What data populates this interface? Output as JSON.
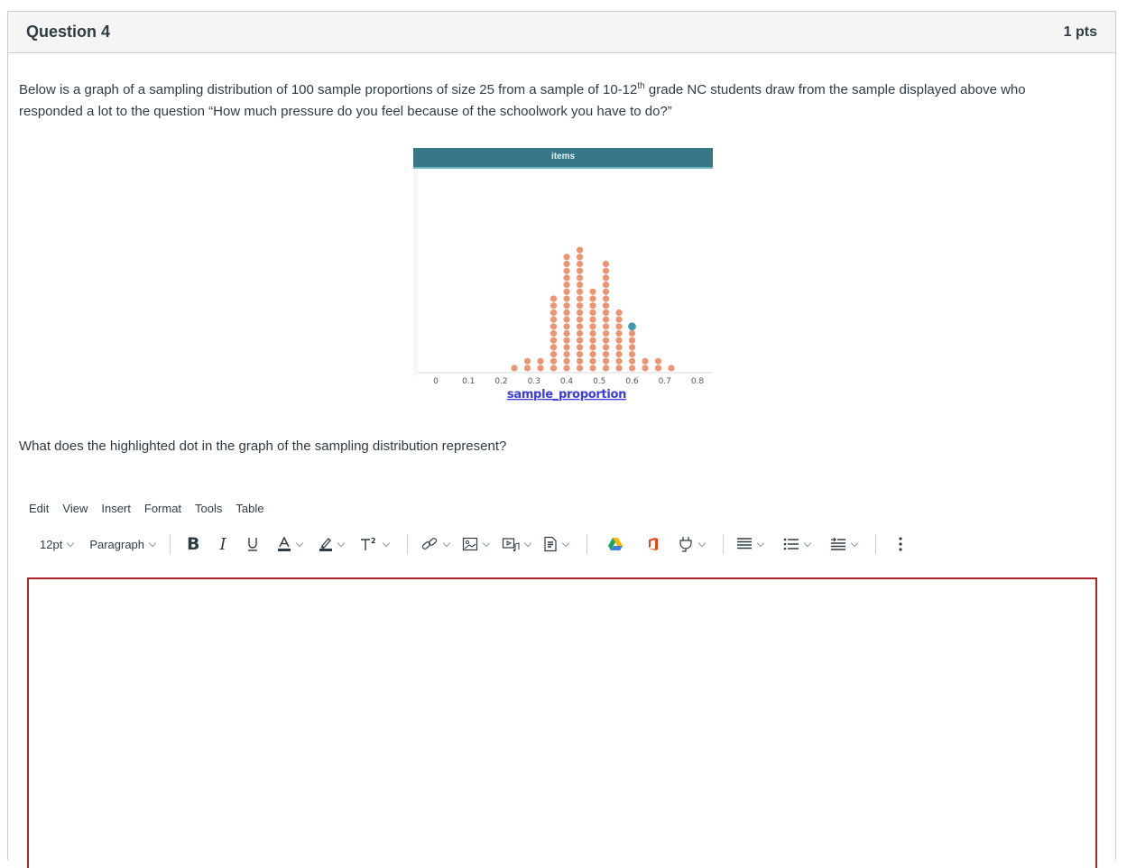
{
  "question": {
    "title": "Question 4",
    "points": "1 pts",
    "text_before_sup": "Below is a graph of a sampling distribution of 100 sample proportions of size 25 from a sample of 10-12",
    "text_sup": "th",
    "text_after_sup": " grade NC students draw from the sample displayed above who responded a lot to the question “How much pressure do you feel because of the schoolwork you have to do?”",
    "prompt": "What does the highlighted dot in the graph of the sampling distribution represent?"
  },
  "chart_data": {
    "type": "scatter",
    "subtype": "dot plot",
    "title": "items",
    "xlabel": "sample_proportion",
    "ylabel": "",
    "xlim": [
      0,
      0.8
    ],
    "x_ticks": [
      "0",
      "0.1",
      "0.2",
      "0.3",
      "0.4",
      "0.5",
      "0.6",
      "0.7",
      "0.8"
    ],
    "x_tick_values": [
      0,
      0.1,
      0.2,
      0.3,
      0.4,
      0.5,
      0.6,
      0.7,
      0.8
    ],
    "bins": [
      0.24,
      0.28,
      0.32,
      0.36,
      0.4,
      0.44,
      0.48,
      0.52,
      0.56,
      0.6,
      0.64,
      0.68,
      0.72
    ],
    "counts": [
      1,
      2,
      2,
      11,
      17,
      18,
      12,
      16,
      9,
      7,
      2,
      2,
      1
    ],
    "total": 100,
    "highlighted": {
      "x": 0.6,
      "stack_index": 7
    },
    "colors": {
      "dot": "#ec9572",
      "highlight": "#3f98ac",
      "header": "#367888"
    },
    "grid": false
  },
  "editor": {
    "menu": [
      "Edit",
      "View",
      "Insert",
      "Format",
      "Tools",
      "Table"
    ],
    "font_size": "12pt",
    "block_format": "Paragraph",
    "content": ""
  }
}
